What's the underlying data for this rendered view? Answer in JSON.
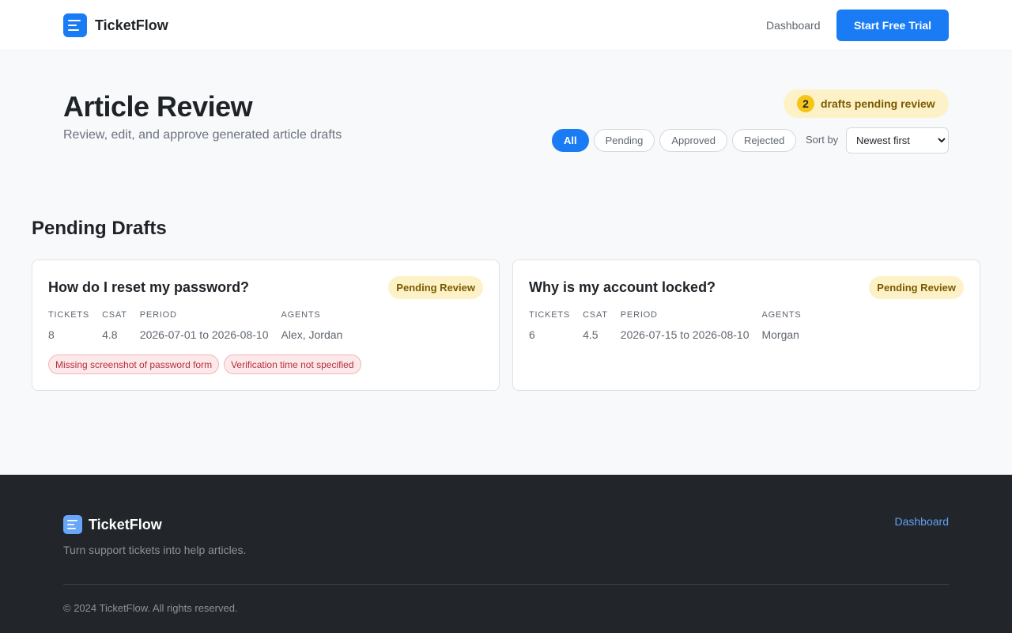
{
  "header": {
    "brand": "TicketFlow",
    "nav_dashboard": "Dashboard",
    "cta": "Start Free Trial"
  },
  "page": {
    "title": "Article Review",
    "subtitle": "Review, edit, and approve generated article drafts",
    "pending_count": "2",
    "pending_text": "drafts pending review"
  },
  "filters": {
    "all": "All",
    "pending": "Pending",
    "approved": "Approved",
    "rejected": "Rejected",
    "sort_label": "Sort by",
    "sort_value": "Newest first"
  },
  "section": {
    "title": "Pending Drafts"
  },
  "labels": {
    "tickets": "TICKETS",
    "csat": "CSAT",
    "period": "PERIOD",
    "agents": "AGENTS"
  },
  "drafts": [
    {
      "title": "How do I reset my password?",
      "status": "Pending Review",
      "tickets": "8",
      "csat": "4.8",
      "period": "2026-07-01 to 2026-08-10",
      "agents": "Alex, Jordan",
      "issues": [
        "Missing screenshot of password form",
        "Verification time not specified"
      ]
    },
    {
      "title": "Why is my account locked?",
      "status": "Pending Review",
      "tickets": "6",
      "csat": "4.5",
      "period": "2026-07-15 to 2026-08-10",
      "agents": "Morgan"
    }
  ],
  "footer": {
    "brand": "TicketFlow",
    "tagline": "Turn support tickets into help articles.",
    "link_dashboard": "Dashboard",
    "copyright": "© 2024 TicketFlow. All rights reserved."
  },
  "colors": {
    "accent": "#1a7cf5",
    "pending_bg": "#fdf2c7",
    "issue_bg": "#fde8ea",
    "footer_bg": "#22262b"
  },
  "icons": {
    "brand_logo": "document-lines-icon",
    "sort_chevron": "chevron-down-icon"
  }
}
